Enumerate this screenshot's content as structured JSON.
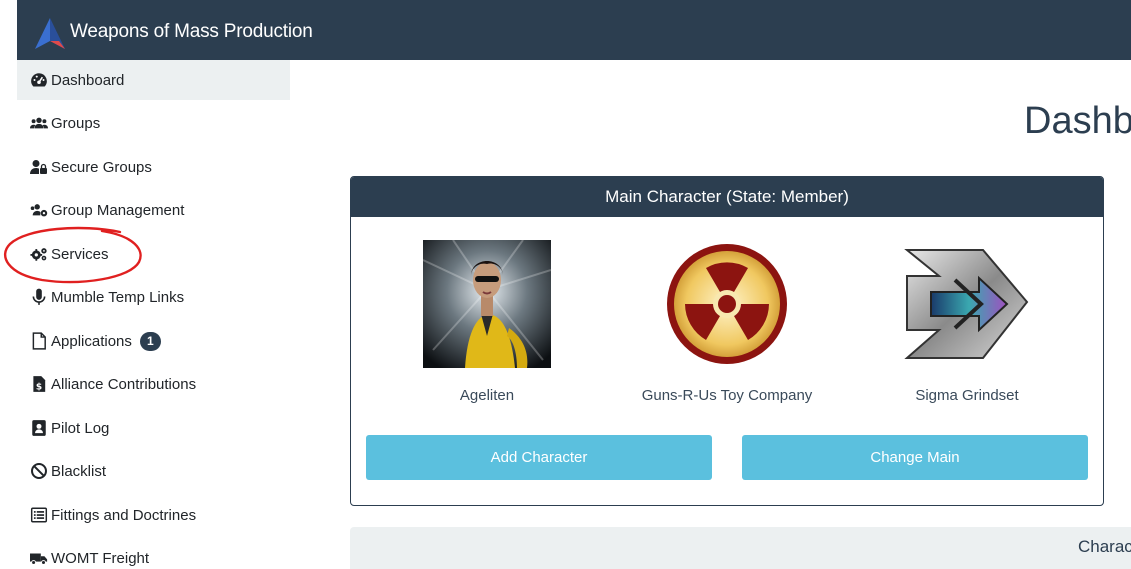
{
  "navbar": {
    "brand": "Weapons of Mass Production",
    "bg_color": "#2c3e50"
  },
  "sidebar": {
    "items": [
      {
        "label": "Dashboard",
        "icon": "dashboard-icon",
        "active": true
      },
      {
        "label": "Groups",
        "icon": "users-icon"
      },
      {
        "label": "Secure Groups",
        "icon": "user-lock-icon"
      },
      {
        "label": "Group Management",
        "icon": "users-cog-icon"
      },
      {
        "label": "Services",
        "icon": "cogs-icon"
      },
      {
        "label": "Mumble Temp Links",
        "icon": "microphone-icon"
      },
      {
        "label": "Applications",
        "icon": "file-icon",
        "badge": "1"
      },
      {
        "label": "Alliance Contributions",
        "icon": "file-invoice-dollar-icon"
      },
      {
        "label": "Pilot Log",
        "icon": "address-book-icon"
      },
      {
        "label": "Blacklist",
        "icon": "ban-icon"
      },
      {
        "label": "Fittings and Doctrines",
        "icon": "list-alt-icon"
      },
      {
        "label": "WOMT Freight",
        "icon": "truck-icon"
      }
    ]
  },
  "main": {
    "title": "Dashb",
    "main_character": {
      "header": "Main Character (State: Member)",
      "characters": [
        {
          "name": "Ageliten",
          "portrait": "character-portrait"
        },
        {
          "name": "Guns-R-Us Toy Company",
          "portrait": "corporation-logo"
        },
        {
          "name": "Sigma Grindset",
          "portrait": "alliance-logo"
        }
      ],
      "add_button": "Add Character",
      "change_button": "Change Main"
    },
    "characters_panel": {
      "header": "Charac"
    }
  },
  "colors": {
    "accent": "#5bc0de",
    "annotation": "#e02020",
    "active_bg": "#ecf0f1"
  }
}
